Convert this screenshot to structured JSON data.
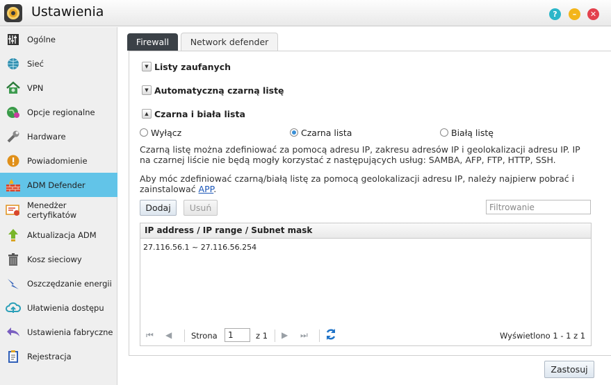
{
  "window": {
    "title": "Ustawienia",
    "help_glyph": "?",
    "minimize_glyph": "–",
    "close_glyph": "✕"
  },
  "sidebar": {
    "items": [
      {
        "label": "Ogólne",
        "icon": "general-icon",
        "active": false
      },
      {
        "label": "Sieć",
        "icon": "network-globe-icon",
        "active": false
      },
      {
        "label": "VPN",
        "icon": "vpn-house-icon",
        "active": false
      },
      {
        "label": "Opcje regionalne",
        "icon": "regional-globe-icon",
        "active": false
      },
      {
        "label": "Hardware",
        "icon": "hardware-wrench-icon",
        "active": false
      },
      {
        "label": "Powiadomienie",
        "icon": "notification-warning-icon",
        "active": false
      },
      {
        "label": "ADM Defender",
        "icon": "firewall-icon",
        "active": true
      },
      {
        "label": "Menedżer certyfikatów",
        "icon": "certificate-icon",
        "active": false
      },
      {
        "label": "Aktualizacja ADM",
        "icon": "update-arrow-icon",
        "active": false
      },
      {
        "label": "Kosz sieciowy",
        "icon": "trash-icon",
        "active": false
      },
      {
        "label": "Oszczędzanie energii",
        "icon": "energy-bolt-icon",
        "active": false
      },
      {
        "label": "Ułatwienia dostępu",
        "icon": "cloud-upload-icon",
        "active": false
      },
      {
        "label": "Ustawienia fabryczne",
        "icon": "reset-arrow-icon",
        "active": false
      },
      {
        "label": "Rejestracja",
        "icon": "registration-clipboard-icon",
        "active": false
      }
    ]
  },
  "tabs": {
    "firewall": "Firewall",
    "network_defender": "Network defender",
    "active": "Network defender"
  },
  "sections": {
    "trusted": "Listy zaufanych",
    "auto_blacklist": "Automatyczną czarną listę",
    "black_white": "Czarna i biała lista"
  },
  "radios": {
    "disable": "Wyłącz",
    "blacklist": "Czarna lista",
    "whitelist": "Białą listę",
    "selected": "Czarna lista"
  },
  "description": {
    "line1": "Czarną listę można zdefiniować za pomocą adresu IP, zakresu adresów IP i geolokalizacji adresu IP. IP na czarnej liście nie będą mogły korzystać z następujących usług: SAMBA, AFP, FTP, HTTP, SSH.",
    "line2_prefix": "Aby móc zdefiniować czarną/białą listę za pomocą geolokalizacji adresu IP, należy najpierw pobrać i zainstalować ",
    "line2_link": "APP",
    "line2_suffix": "."
  },
  "toolbar": {
    "add_label": "Dodaj",
    "remove_label": "Usuń",
    "filter_placeholder": "Filtrowanie"
  },
  "grid": {
    "column_header": "IP address / IP range / Subnet mask",
    "rows": [
      "27.116.56.1 ~ 27.116.56.254"
    ]
  },
  "pager": {
    "page_label": "Strona",
    "page_value": "1",
    "of_label": "z 1",
    "display_info": "Wyświetlono 1 - 1 z 1"
  },
  "footer": {
    "apply_label": "Zastosuj"
  },
  "colors": {
    "active_sidebar": "#62c4e8",
    "active_tab": "#3b4147",
    "link": "#1a56b8"
  }
}
